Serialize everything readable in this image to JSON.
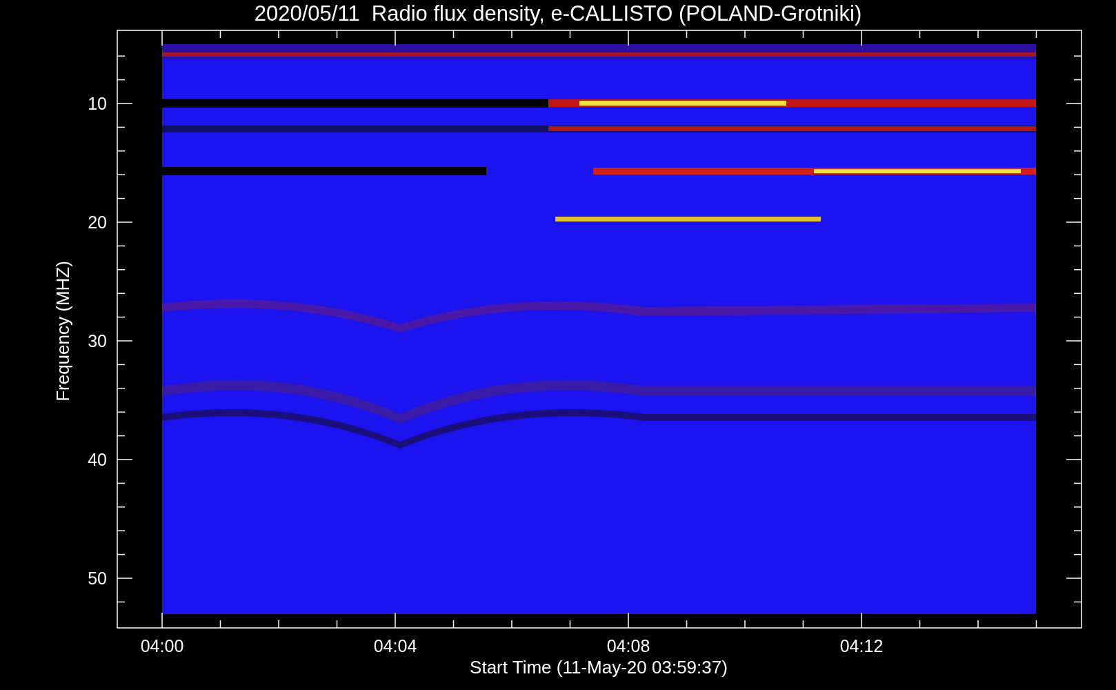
{
  "title": "2020/05/11  Radio flux density, e-CALLISTO (POLAND-Grotniki)",
  "ylabel": "Frequency (MHZ)",
  "xlabel": "Start Time (11-May-20 03:59:37)",
  "xticks": [
    {
      "label": "04:00"
    },
    {
      "label": "04:04"
    },
    {
      "label": "04:08"
    },
    {
      "label": "04:12"
    }
  ],
  "yticks": [
    {
      "label": "10"
    },
    {
      "label": "20"
    },
    {
      "label": "30"
    },
    {
      "label": "40"
    },
    {
      "label": "50"
    }
  ]
}
